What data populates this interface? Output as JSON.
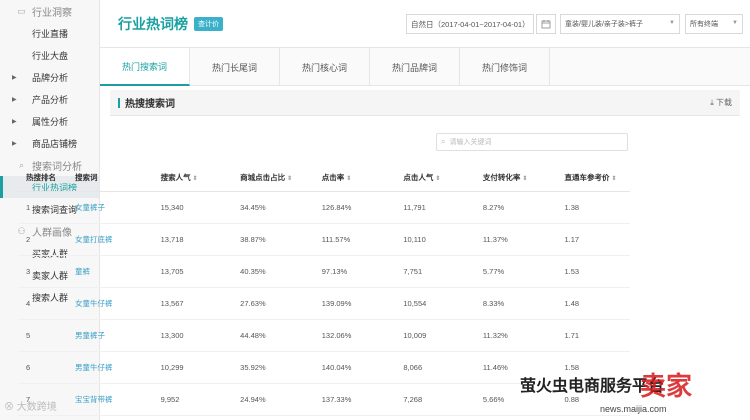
{
  "sidebar": {
    "sections": [
      {
        "label": "行业洞察",
        "icon": "monitor-icon",
        "items": [
          {
            "label": "行业直播",
            "has_arrow": false
          },
          {
            "label": "行业大盘",
            "has_arrow": false
          },
          {
            "label": "品牌分析",
            "has_arrow": true
          },
          {
            "label": "产品分析",
            "has_arrow": true
          },
          {
            "label": "属性分析",
            "has_arrow": true
          },
          {
            "label": "商品店铺榜",
            "has_arrow": true
          }
        ]
      },
      {
        "label": "搜索词分析",
        "icon": "search-doc-icon",
        "items": [
          {
            "label": "行业热词榜",
            "has_arrow": false,
            "active": true
          },
          {
            "label": "搜索词查询",
            "has_arrow": false
          }
        ]
      },
      {
        "label": "人群画像",
        "icon": "people-icon",
        "items": [
          {
            "label": "买家人群",
            "has_arrow": false
          },
          {
            "label": "卖家人群",
            "has_arrow": false
          },
          {
            "label": "搜索人群",
            "has_arrow": false
          }
        ]
      }
    ]
  },
  "header": {
    "title": "行业热词榜",
    "badge": "查计价",
    "date_range": "自然日（2017-04-01~2017-04-01）",
    "category": "童装/婴儿装/亲子装>裤子",
    "terminal": "所有终端"
  },
  "tabs": [
    "热门搜索词",
    "热门长尾词",
    "热门核心词",
    "热门品牌词",
    "热门修饰词"
  ],
  "active_tab": 0,
  "section": {
    "title": "热搜搜索词",
    "download": "下载",
    "search_placeholder": "请输入关键词"
  },
  "table": {
    "headers": [
      "热搜排名",
      "搜索词",
      "搜索人气",
      "商城点击占比",
      "点击率",
      "点击人气",
      "支付转化率",
      "直通车参考价"
    ],
    "sortable": [
      false,
      false,
      true,
      true,
      true,
      true,
      true,
      true
    ],
    "rows": [
      [
        "1",
        "女童裤子",
        "15,340",
        "34.45%",
        "126.84%",
        "11,791",
        "8.27%",
        "1.38"
      ],
      [
        "2",
        "女童打底裤",
        "13,718",
        "38.87%",
        "111.57%",
        "10,110",
        "11.37%",
        "1.17"
      ],
      [
        "3",
        "童裤",
        "13,705",
        "40.35%",
        "97.13%",
        "7,751",
        "5.77%",
        "1.53"
      ],
      [
        "4",
        "女童牛仔裤",
        "13,567",
        "27.63%",
        "139.09%",
        "10,554",
        "8.33%",
        "1.48"
      ],
      [
        "5",
        "男童裤子",
        "13,300",
        "44.48%",
        "132.06%",
        "10,009",
        "11.32%",
        "1.71"
      ],
      [
        "6",
        "男童牛仔裤",
        "10,299",
        "35.92%",
        "140.04%",
        "8,066",
        "11.46%",
        "1.58"
      ],
      [
        "7",
        "宝宝背带裤",
        "9,952",
        "24.94%",
        "137.33%",
        "7,268",
        "5.66%",
        "0.88"
      ]
    ]
  },
  "watermarks": {
    "left": "大数跨境",
    "right_cn": "萤火虫电商服务平台",
    "right_brand": "卖家",
    "right_url": "news.maijia.com"
  }
}
